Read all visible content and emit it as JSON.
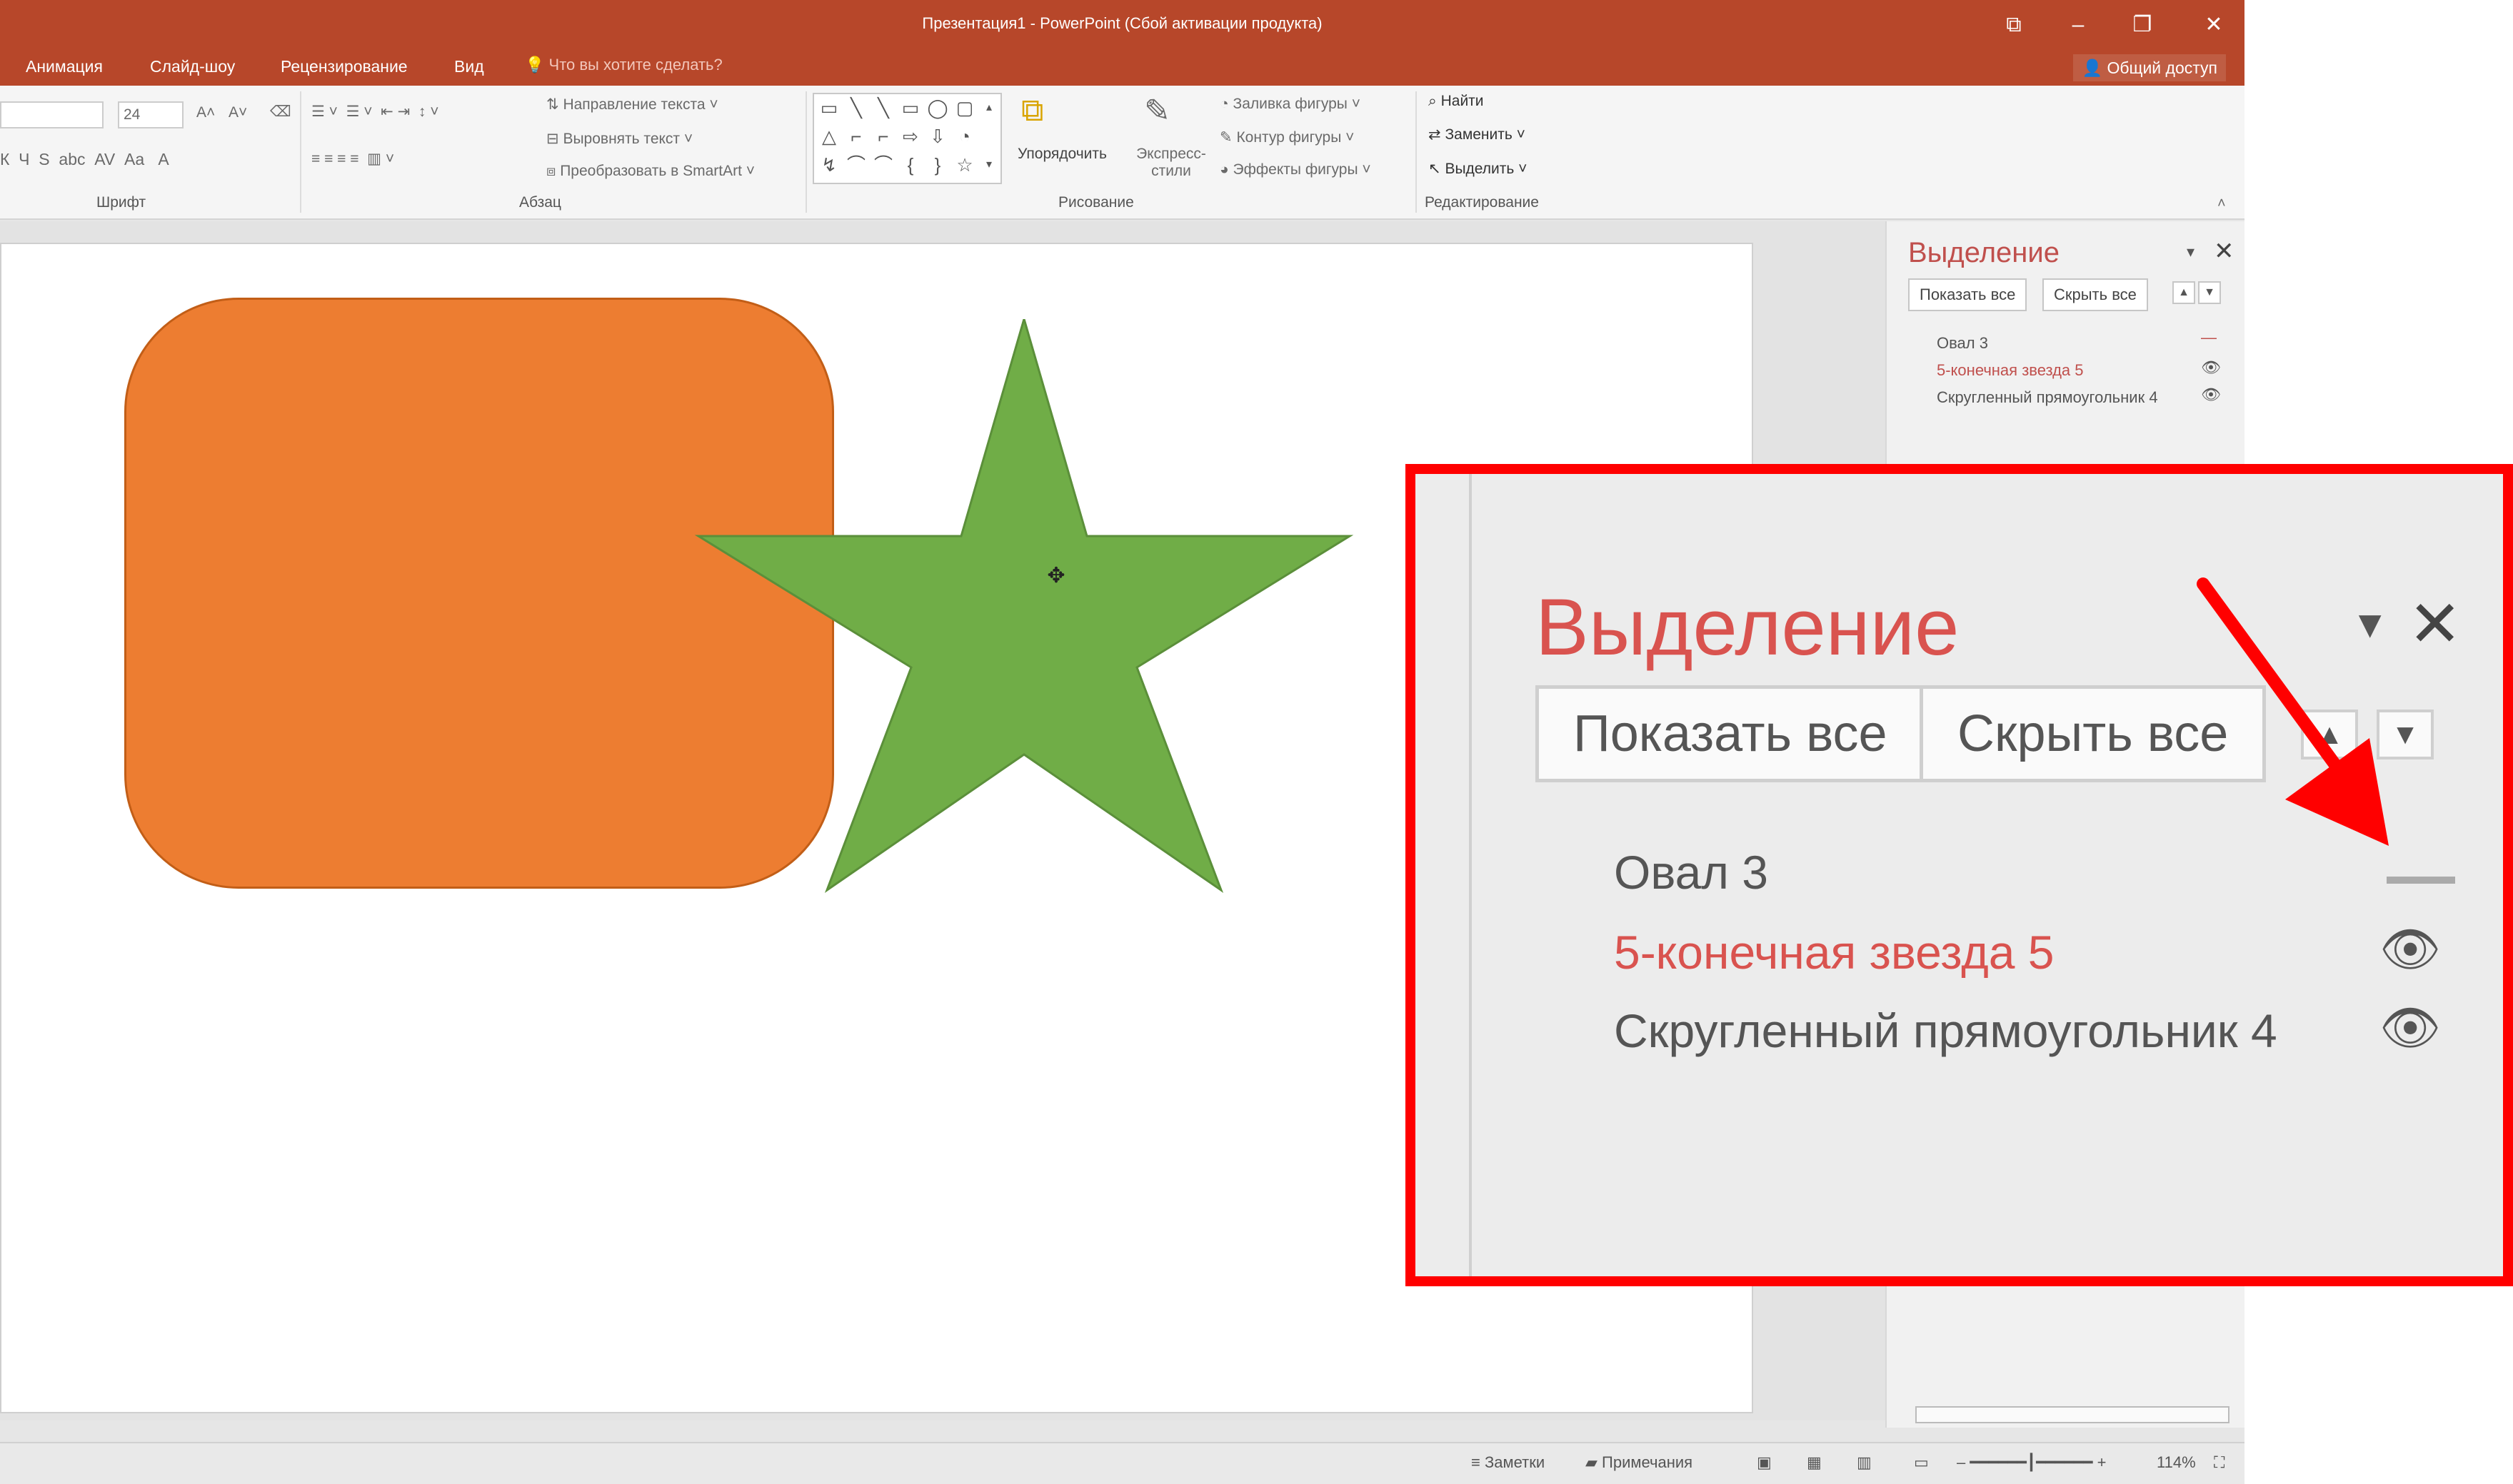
{
  "window": {
    "title": "Презентация1 - PowerPoint (Сбой активации продукта)",
    "share_label": "Общий доступ"
  },
  "tabs": [
    "Анимация",
    "Слайд-шоу",
    "Рецензирование",
    "Вид"
  ],
  "tell_me": "Что вы хотите сделать?",
  "ribbon": {
    "font_size": "24",
    "groups": {
      "font": "Шрифт",
      "paragraph": "Абзац",
      "drawing": "Рисование",
      "editing": "Редактирование"
    },
    "paragraph_buttons": {
      "text_direction": "Направление текста",
      "align_text": "Выровнять текст",
      "smartart": "Преобразовать в SmartArt"
    },
    "drawing_buttons": {
      "arrange": "Упорядочить",
      "quick_styles": "Экспресс-стили",
      "shape_fill": "Заливка фигуры",
      "shape_outline": "Контур фигуры",
      "shape_effects": "Эффекты фигуры"
    },
    "editing_buttons": {
      "find": "Найти",
      "replace": "Заменить",
      "select": "Выделить"
    }
  },
  "selection_pane": {
    "title": "Выделение",
    "show_all": "Показать все",
    "hide_all": "Скрыть все",
    "items": [
      {
        "label": "Овал 3",
        "visible": false
      },
      {
        "label": "5-конечная звезда 5",
        "visible": true,
        "selected": true
      },
      {
        "label": "Скругленный прямоугольник 4",
        "visible": true
      }
    ]
  },
  "status": {
    "notes": "Заметки",
    "comments": "Примечания",
    "zoom": "114%"
  },
  "colors": {
    "title_bar": "#b7472a",
    "rounded_rect_fill": "#ed7d31",
    "star_fill": "#70ad47",
    "highlight": "#ff0000",
    "pane_title": "#c0504d"
  },
  "icons": {
    "eye": "eye-icon",
    "hidden": "hidden-dash-icon",
    "close": "close-icon",
    "dropdown": "chevron-down-icon"
  }
}
